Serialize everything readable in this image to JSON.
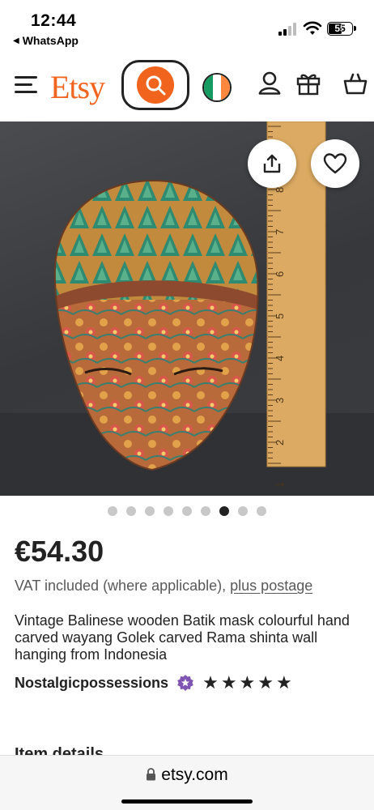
{
  "status_bar": {
    "time": "12:44",
    "back_app": "WhatsApp",
    "battery": "55"
  },
  "header": {
    "logo": "Etsy",
    "icons": [
      "menu-icon",
      "search-icon",
      "ireland-flag-icon",
      "account-icon",
      "gift-icon",
      "cart-icon"
    ]
  },
  "gallery": {
    "image_count": 9,
    "active_index": 6,
    "ruler_numbers": [
      "8",
      "7",
      "6",
      "5",
      "4",
      "3",
      "2",
      "1"
    ],
    "icons": [
      "share-icon",
      "heart-icon"
    ]
  },
  "listing": {
    "price": "€54.30",
    "vat_text": "VAT included (where applicable), ",
    "postage_link": "plus postage",
    "title": "Vintage Balinese wooden Batik mask colourful hand carved wayang Golek carved Rama shinta wall hanging from Indonesia",
    "shop_name": "Nostalgicpossessions",
    "rating_stars": 5,
    "next_section": "Item details"
  },
  "browser": {
    "url": "etsy.com"
  },
  "colors": {
    "brand_orange": "#f1641e",
    "text": "#222222",
    "muted": "#595959",
    "star_seller_purple": "#7f54b3"
  }
}
